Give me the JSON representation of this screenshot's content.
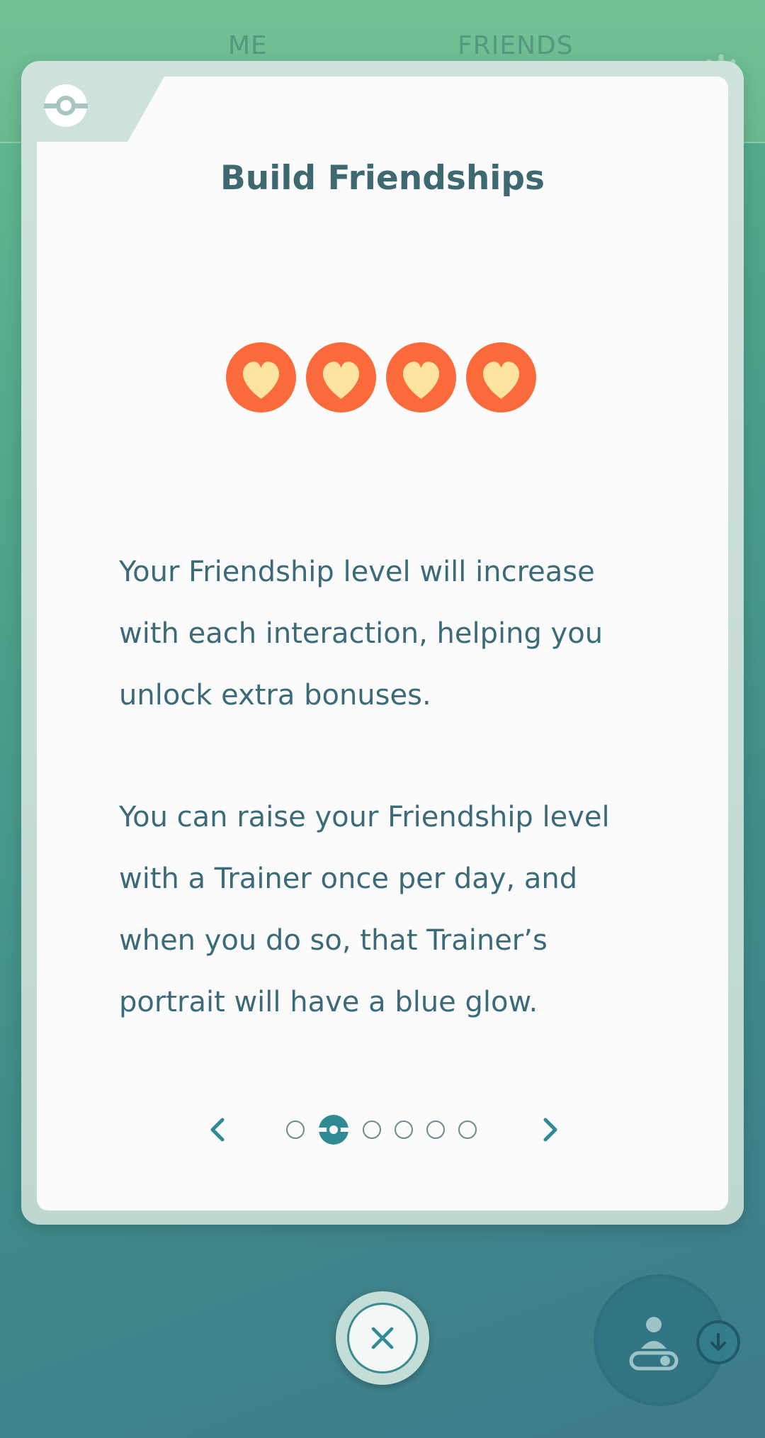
{
  "background": {
    "tabs": [
      {
        "label": "ME"
      },
      {
        "label": "FRIENDS"
      }
    ]
  },
  "modal": {
    "title": "Build Friendships",
    "hearts_count": 4,
    "paragraphs": [
      "Your Friendship level will increase with each interaction, helping you unlock extra bonuses.",
      "You can raise your Friendship level with a Trainer once per day, and when you do so, that Trainer’s portrait will have a blue glow."
    ],
    "pager": {
      "total_pages": 6,
      "current_page": 2
    }
  },
  "icons": {
    "ball": "pokeball-icon",
    "heart": "heart-icon",
    "prev": "chevron-left-icon",
    "next": "chevron-right-icon",
    "close": "close-icon",
    "settings": "gear-icon",
    "fab": "trainer-icon",
    "download": "download-icon"
  },
  "colors": {
    "heart_fill": "#fb6a3a",
    "heart_inner": "#fde3a0",
    "text": "#3b6a78",
    "title": "#3f6970",
    "accent": "#2f8a94"
  }
}
